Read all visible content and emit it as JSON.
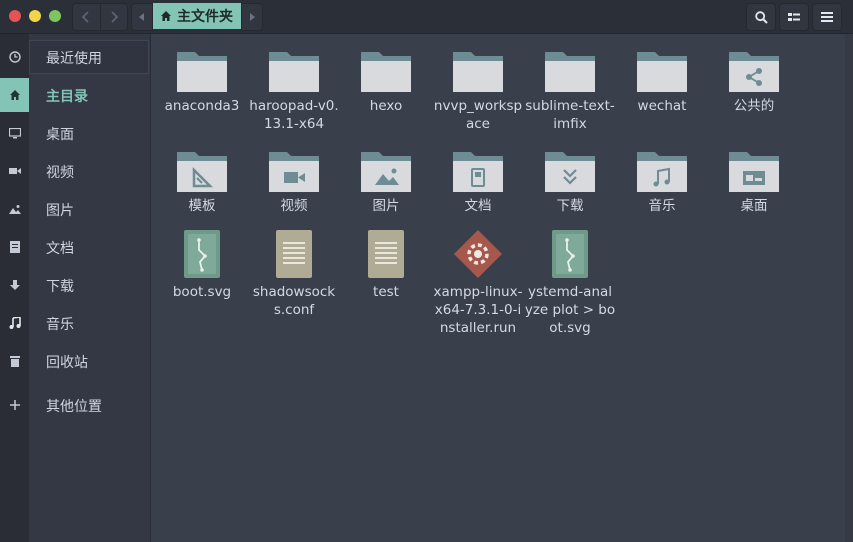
{
  "window": {
    "title": "主文件夹"
  },
  "header": {
    "path_label": "主文件夹",
    "back_icon": "chevron-left-icon",
    "forward_icon": "chevron-right-icon"
  },
  "sidebar": {
    "items": [
      {
        "label": "最近使用",
        "icon": "clock-icon"
      },
      {
        "label": "主目录",
        "icon": "home-icon",
        "active": true
      },
      {
        "label": "桌面",
        "icon": "desktop-icon"
      },
      {
        "label": "视频",
        "icon": "video-icon"
      },
      {
        "label": "图片",
        "icon": "picture-icon"
      },
      {
        "label": "文档",
        "icon": "document-icon"
      },
      {
        "label": "下载",
        "icon": "download-icon"
      },
      {
        "label": "音乐",
        "icon": "music-icon"
      },
      {
        "label": "回收站",
        "icon": "trash-icon"
      },
      {
        "label": "其他位置",
        "icon": "plus-icon"
      }
    ]
  },
  "files": [
    {
      "name": "anaconda3",
      "type": "folder"
    },
    {
      "name": "haroopad-v0.13.1-x64",
      "type": "folder"
    },
    {
      "name": "hexo",
      "type": "folder"
    },
    {
      "name": "nvvp_workspace",
      "type": "folder"
    },
    {
      "name": "sublime-text-imfix",
      "type": "folder"
    },
    {
      "name": "wechat",
      "type": "folder"
    },
    {
      "name": "公共的",
      "type": "folder-share"
    },
    {
      "name": "模板",
      "type": "folder-templates"
    },
    {
      "name": "视频",
      "type": "folder-video"
    },
    {
      "name": "图片",
      "type": "folder-pictures"
    },
    {
      "name": "文档",
      "type": "folder-documents"
    },
    {
      "name": "下载",
      "type": "folder-download"
    },
    {
      "name": "音乐",
      "type": "folder-music"
    },
    {
      "name": "桌面",
      "type": "folder-desktop"
    },
    {
      "name": "boot.svg",
      "type": "svg-file"
    },
    {
      "name": "shadowsocks.conf",
      "type": "text-file"
    },
    {
      "name": "test",
      "type": "text-file"
    },
    {
      "name": "xampp-linux-x64-7.3.1-0-installer.run",
      "type": "executable"
    },
    {
      "name": "ystemd-analyze plot > boot.svg",
      "type": "svg-file"
    }
  ],
  "colors": {
    "accent": "#84c4b6",
    "folder_tab": "#6e8c94",
    "folder_body": "#d8dadd",
    "background": "#3a3f4c",
    "sidebar": "#333844"
  }
}
